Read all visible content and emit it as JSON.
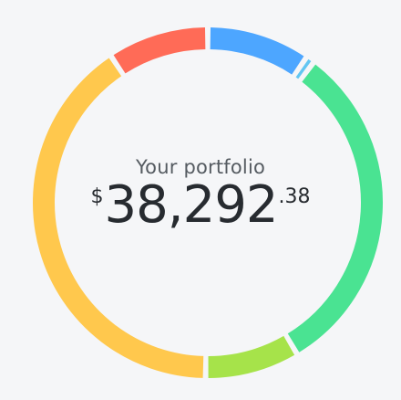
{
  "portfolio": {
    "label": "Your portfolio",
    "currency_symbol": "$",
    "whole": "38,292",
    "cents": ".38"
  },
  "chart_data": {
    "type": "pie",
    "segments": [
      {
        "color": "#4da6ff",
        "value": 9.5
      },
      {
        "color": "#62c6f2",
        "value": 0.8
      },
      {
        "color": "#4ae392",
        "value": 31.2
      },
      {
        "color": "#a6e34a",
        "value": 8.7
      },
      {
        "color": "#ffc84d",
        "value": 40.5
      },
      {
        "color": "#ff6b57",
        "value": 9.3
      }
    ]
  }
}
